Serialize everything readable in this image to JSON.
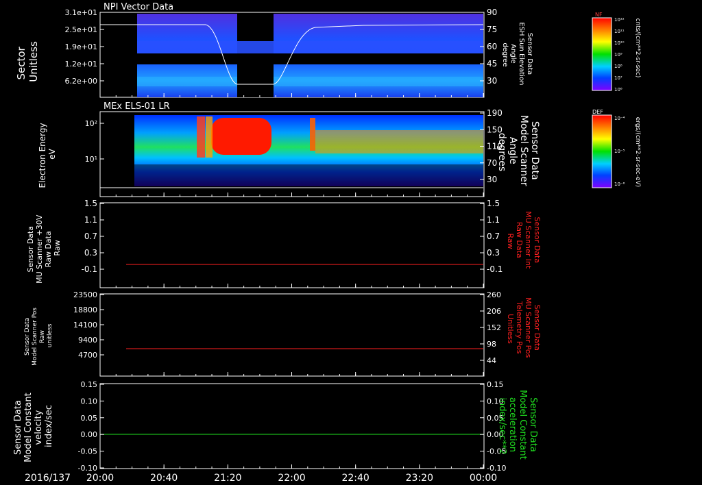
{
  "colors": {
    "white": "#ffffff",
    "red": "#ff2020",
    "green": "#20e020",
    "black": "#000000"
  },
  "time_axis": {
    "date": "2016/137",
    "ticks": [
      "20:00",
      "20:40",
      "21:20",
      "22:00",
      "22:40",
      "23:20",
      "00:00"
    ]
  },
  "panels": [
    {
      "id": "p1",
      "title": "NPI Vector Data",
      "left_label": [
        "Sector",
        "Unitless"
      ],
      "left_ticks": [
        "3.1e+01",
        "2.5e+01",
        "1.9e+01",
        "1.2e+01",
        "6.2e+00"
      ],
      "right_label": [
        "Sensor Data",
        "ESH Sun Elevation",
        "Angle",
        "degree"
      ],
      "right_ticks": [
        "90",
        "75",
        "60",
        "45",
        "30"
      ],
      "colorbar": {
        "title": "NF",
        "unit": "cnts/(cm**2-sr-sec)",
        "ticks": [
          "10¹²",
          "10¹¹",
          "10¹⁰",
          "10⁹",
          "10⁸",
          "10⁷",
          "10⁶"
        ]
      }
    },
    {
      "id": "p2",
      "title": "MEx ELS-01 LR",
      "left_label": [
        "Electron Energy",
        "eV"
      ],
      "left_ticks": [
        "10²",
        "10¹"
      ],
      "right_label": [
        "Sensor Data",
        "Model Scanner",
        "Angle",
        "degrees"
      ],
      "right_ticks": [
        "190",
        "150",
        "110",
        "70",
        "30"
      ],
      "colorbar": {
        "title": "DEF",
        "unit": "ergs/(cm**2-sr-sec-eV)",
        "ticks": [
          "10⁻⁴",
          "10⁻⁵",
          "10⁻⁶"
        ]
      }
    },
    {
      "id": "p3",
      "left_label": [
        "Sensor Data",
        "MU Scanner +30V",
        "Raw Data",
        "Raw"
      ],
      "left_ticks": [
        "1.5",
        "1.1",
        "0.7",
        "0.3",
        "-0.1"
      ],
      "right_label": [
        "Sensor Data",
        "MU Scanner Int",
        "Raw Data",
        "Raw"
      ],
      "right_ticks": [
        "1.5",
        "1.1",
        "0.7",
        "0.3",
        "-0.1"
      ]
    },
    {
      "id": "p4",
      "left_label": [
        "Sensor Data",
        "Model Scanner Pos",
        "Raw",
        "unitless"
      ],
      "left_ticks": [
        "23500",
        "18800",
        "14100",
        "9400",
        "4700"
      ],
      "right_label": [
        "Sensor Data",
        "MU Scanner Pos",
        "Telemetry Pos",
        "Unitless"
      ],
      "right_ticks": [
        "260",
        "206",
        "152",
        "98",
        "44"
      ]
    },
    {
      "id": "p5",
      "left_label": [
        "Sensor Data",
        "Model Constant",
        "velocity",
        "index/sec"
      ],
      "left_ticks": [
        "0.15",
        "0.10",
        "0.05",
        "0.00",
        "-0.05",
        "-0.10"
      ],
      "right_label": [
        "Sensor Data",
        "Model Constant",
        "acceleration",
        "index/sec**2"
      ],
      "right_ticks": [
        "0.15",
        "0.10",
        "0.05",
        "0.00",
        "-0.05",
        "-0.10"
      ]
    }
  ],
  "chart_data": [
    {
      "type": "heatmap",
      "title": "NPI Vector Data",
      "x_range": [
        "20:00",
        "00:00"
      ],
      "ylabel": "Sector Unitless",
      "ylim": [
        0,
        31
      ],
      "y2label": "Sensor Data ESH Sun Elevation Angle degree",
      "data_gaps": [
        [
          "20:00",
          "20:25"
        ],
        [
          "21:33",
          "21:54"
        ]
      ],
      "overlay_series": {
        "name": "ESH Sun Elevation Angle",
        "x": [
          "20:25",
          "21:00",
          "21:10",
          "21:20",
          "21:33",
          "21:45",
          "21:54",
          "22:05",
          "22:15",
          "22:30",
          "23:00",
          "00:00"
        ],
        "y": [
          80,
          80,
          74,
          50,
          32,
          32,
          32,
          58,
          75,
          79,
          80,
          80
        ]
      },
      "zlabel": "cnts/(cm**2-sr-sec)"
    },
    {
      "type": "heatmap",
      "title": "MEx ELS-01 LR",
      "x_range": [
        "20:00",
        "00:00"
      ],
      "ylabel": "Electron Energy eV",
      "yscale": "log",
      "data_gaps": [
        [
          "20:00",
          "20:25"
        ]
      ],
      "high_flux_intervals": [
        [
          "21:05",
          "21:08"
        ],
        [
          "21:10",
          "21:45"
        ],
        [
          "22:16",
          "22:18"
        ],
        [
          "22:18",
          "23:59"
        ]
      ],
      "overlay_series": {
        "name": "Model Scanner Angle",
        "x": [
          "20:00",
          "00:00"
        ],
        "y": [
          10,
          10
        ]
      },
      "zlabel": "ergs/(cm**2-sr-sec-eV)"
    },
    {
      "type": "line",
      "ylim": [
        -0.3,
        1.5
      ],
      "series": [
        {
          "name": "MU Scanner +30V Raw Data",
          "x": [
            "20:20",
            "00:00"
          ],
          "y": [
            -0.1,
            -0.1
          ],
          "color": "#ff2020"
        }
      ]
    },
    {
      "type": "line",
      "ylim": [
        0,
        23500
      ],
      "series": [
        {
          "name": "Model Scanner Pos Raw",
          "x": [
            "20:20",
            "00:00"
          ],
          "y": [
            8700,
            8700
          ],
          "color": "#ff2020"
        }
      ]
    },
    {
      "type": "line",
      "ylim": [
        -0.1,
        0.15
      ],
      "series": [
        {
          "name": "Model Constant velocity",
          "x": [
            "20:00",
            "00:00"
          ],
          "y": [
            0.0,
            0.0
          ],
          "color": "#20e020"
        }
      ]
    }
  ]
}
